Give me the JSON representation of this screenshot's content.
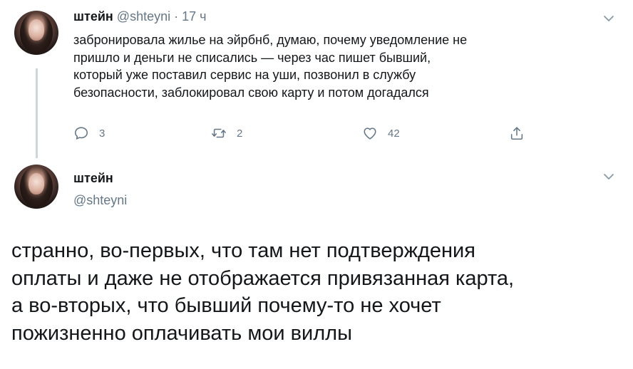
{
  "tweet1": {
    "name": "штейн",
    "handle": "@shteyni",
    "separator": "·",
    "time": "17 ч",
    "lines": [
      "забронировала жилье на эйрбнб, думаю, почему уведомление не",
      "пришло и деньги не списались — через час пишет бывший,",
      "который уже поставил сервис на уши, позвонил в службу",
      "безопасности, заблокировал свою карту и потом догадался"
    ],
    "actions": {
      "reply_count": "3",
      "retweet_count": "2",
      "like_count": "42"
    }
  },
  "tweet2": {
    "name": "штейн",
    "handle": "@shteyni",
    "lines": [
      "странно, во-первых, что там нет подтверждения",
      "оплаты и даже не отображается привязанная карта,",
      "а во-вторых, что бывший почему-то не хочет",
      "пожизненно оплачивать мои виллы"
    ]
  },
  "colors": {
    "text": "#14171a",
    "secondary": "#657786",
    "thread_line": "#ccd6dd"
  },
  "icons": [
    "reply-icon",
    "retweet-icon",
    "like-icon",
    "share-icon",
    "chevron-down-icon"
  ]
}
